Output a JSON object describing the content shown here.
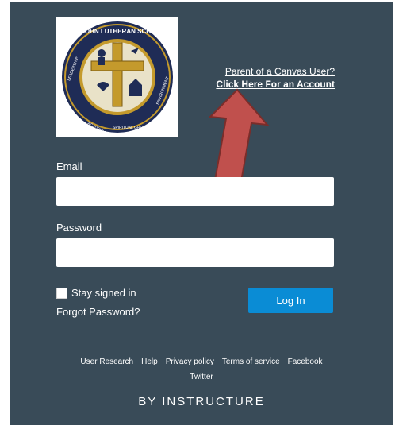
{
  "logo": {
    "school_name": "ST. JOHN LUTHERAN SCHOOL",
    "pillars": [
      "LEADERSHIP",
      "ACADEMICS",
      "SPIRITUAL GROWTH",
      "ENVIRONMENT"
    ]
  },
  "parent_link": {
    "line1": "Parent of a Canvas User?",
    "line2": "Click Here For an Account"
  },
  "form": {
    "email_label": "Email",
    "email_value": "",
    "password_label": "Password",
    "password_value": "",
    "stay_signed_in_label": "Stay signed in",
    "forgot_password_label": "Forgot Password?",
    "login_label": "Log In"
  },
  "footer": {
    "links": [
      "User Research",
      "Help",
      "Privacy policy",
      "Terms of service",
      "Facebook"
    ],
    "twitter": "Twitter",
    "brand": "BY INSTRUCTURE"
  },
  "colors": {
    "panel_bg": "#394b58",
    "login_button": "#0a8cd5",
    "arrow_fill": "#c0504d",
    "logo_gold": "#c49a2c",
    "logo_navy": "#1f2c56"
  }
}
